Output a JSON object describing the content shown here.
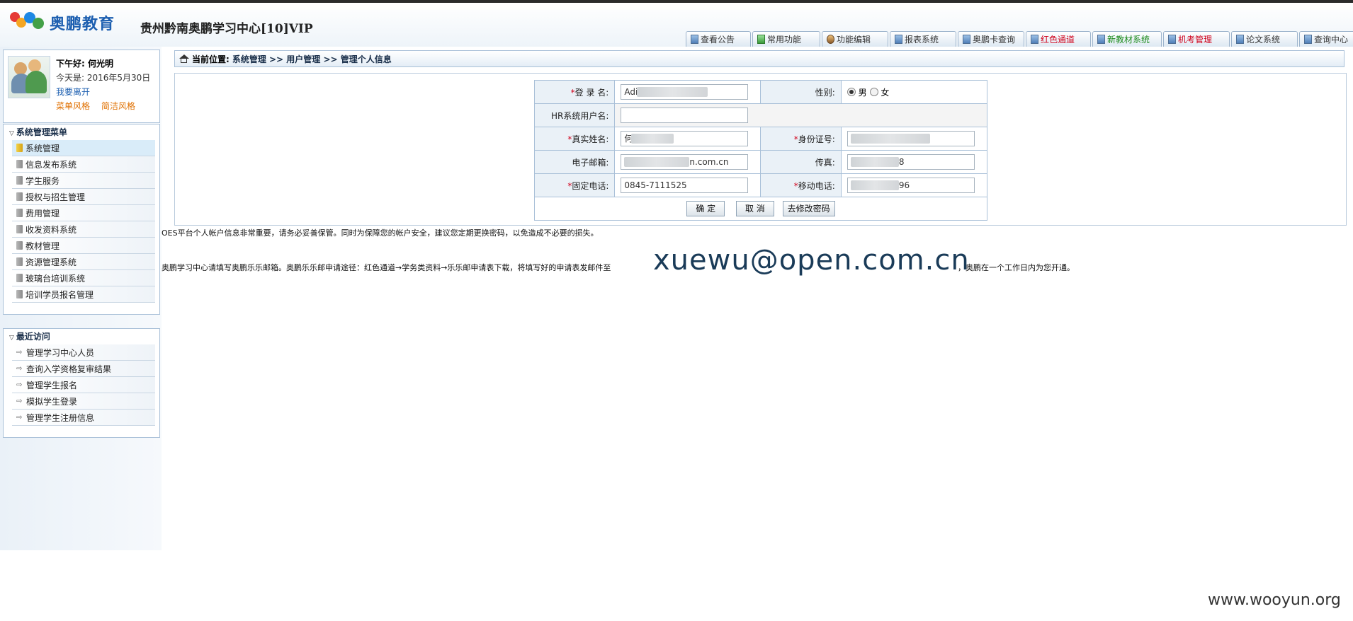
{
  "header": {
    "logo_text": "奥鹏教育",
    "site_title": "贵州黔南奥鹏学习中心[10]VIP"
  },
  "tabs": [
    {
      "label": "查看公告",
      "icon": "notice-icon",
      "color": "#333333"
    },
    {
      "label": "常用功能",
      "icon": "function-icon",
      "color": "#333333"
    },
    {
      "label": "功能编辑",
      "icon": "user-edit-icon",
      "color": "#333333"
    },
    {
      "label": "报表系统",
      "icon": "report-icon",
      "color": "#333333"
    },
    {
      "label": "奥鹏卡查询",
      "icon": "card-icon",
      "color": "#333333"
    },
    {
      "label": "红色通道",
      "icon": "channel-icon",
      "color": "#d0021b"
    },
    {
      "label": "新教材系统",
      "icon": "book-icon",
      "color": "#1a8a1a"
    },
    {
      "label": "机考管理",
      "icon": "exam-icon",
      "color": "#d0021b"
    },
    {
      "label": "论文系统",
      "icon": "paper-icon",
      "color": "#333333"
    },
    {
      "label": "查询中心",
      "icon": "query-icon",
      "color": "#333333"
    }
  ],
  "user": {
    "greeting": "下午好: 何光明",
    "today": "今天是: 2016年5月30日",
    "leave": "我要离开",
    "style_menu": "菜单风格",
    "style_simple": "简洁风格"
  },
  "system_menu": {
    "title": "系统管理菜单",
    "items": [
      {
        "label": "系统管理",
        "selected": true
      },
      {
        "label": "信息发布系统"
      },
      {
        "label": "学生服务"
      },
      {
        "label": "授权与招生管理"
      },
      {
        "label": "费用管理"
      },
      {
        "label": "收发资料系统"
      },
      {
        "label": "教材管理"
      },
      {
        "label": "资源管理系统"
      },
      {
        "label": "玻璃台培训系统"
      },
      {
        "label": "培训学员报名管理"
      }
    ]
  },
  "recent": {
    "title": "最近访问",
    "items": [
      {
        "label": "管理学习中心人员"
      },
      {
        "label": "查询入学资格复审结果"
      },
      {
        "label": "管理学生报名"
      },
      {
        "label": "模拟学生登录"
      },
      {
        "label": "管理学生注册信息"
      }
    ]
  },
  "breadcrumb": {
    "label": "当前位置:",
    "path": "系统管理 >> 用户管理 >> 管理个人信息"
  },
  "form": {
    "login_label": "登 录 名:",
    "login_value": "Adi",
    "gender_label": "性别:",
    "gender_male": "男",
    "gender_female": "女",
    "gender_selected": "男",
    "hr_label": "HR系统用户名:",
    "hr_value": "",
    "realname_label": "真实姓名:",
    "realname_value": "何",
    "id_label": "身份证号:",
    "id_value": "1",
    "email_label": "电子邮箱:",
    "email_value": "n.com.cn",
    "fax_label": "传真:",
    "fax_value": "8",
    "phone_label": "固定电话:",
    "phone_value": "0845-7111525",
    "mobile_label": "移动电话:",
    "mobile_value": "96",
    "confirm": "确  定",
    "cancel": "取  消",
    "change_password": "去修改密码"
  },
  "notes": {
    "security": "OES平台个人帐户信息非常重要，请务必妥善保管。同时为保障您的帐户安全，建议您定期更换密码，以免造成不必要的损失。",
    "mailbox_prefix": "奥鹏学习中心请填写奥鹏乐乐邮箱。奥鹏乐乐邮申请途径：红色通道→学务类资料→乐乐邮申请表下载，将填写好的申请表发邮件至",
    "mailbox_email": "xuewu@open.com.cn",
    "mailbox_suffix": "，奥鹏在一个工作日内为您开通。"
  },
  "watermark": "www.wooyun.org"
}
